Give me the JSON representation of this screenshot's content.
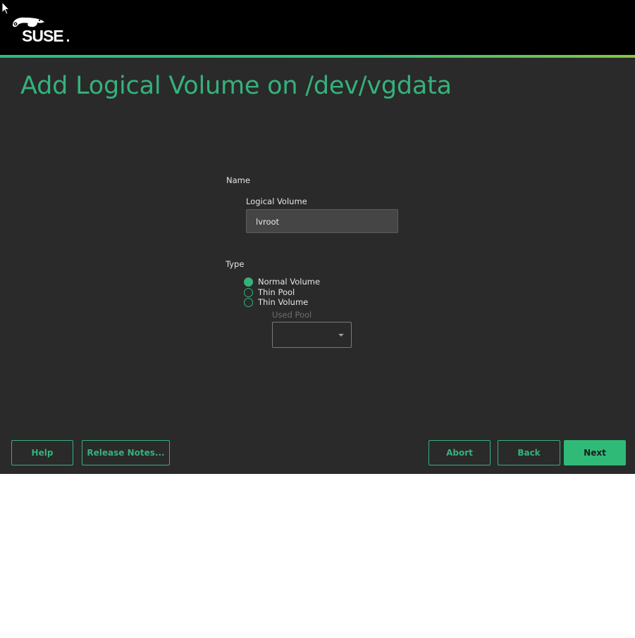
{
  "header": {
    "logo_text": "SUSE"
  },
  "page": {
    "title": "Add Logical Volume on /dev/vgdata"
  },
  "form": {
    "name_section_label": "Name",
    "logical_volume_label": "Logical Volume",
    "logical_volume_value": "lvroot",
    "type_section_label": "Type",
    "type_options": [
      {
        "label": "Normal Volume",
        "checked": true
      },
      {
        "label": "Thin Pool",
        "checked": false
      },
      {
        "label": "Thin Volume",
        "checked": false
      }
    ],
    "used_pool_label": "Used Pool",
    "used_pool_value": ""
  },
  "buttons": {
    "help": "Help",
    "release_notes": "Release Notes...",
    "abort": "Abort",
    "back": "Back",
    "next": "Next"
  },
  "colors": {
    "accent": "#35b27b",
    "background": "#2a2a2a",
    "header": "#000000"
  }
}
